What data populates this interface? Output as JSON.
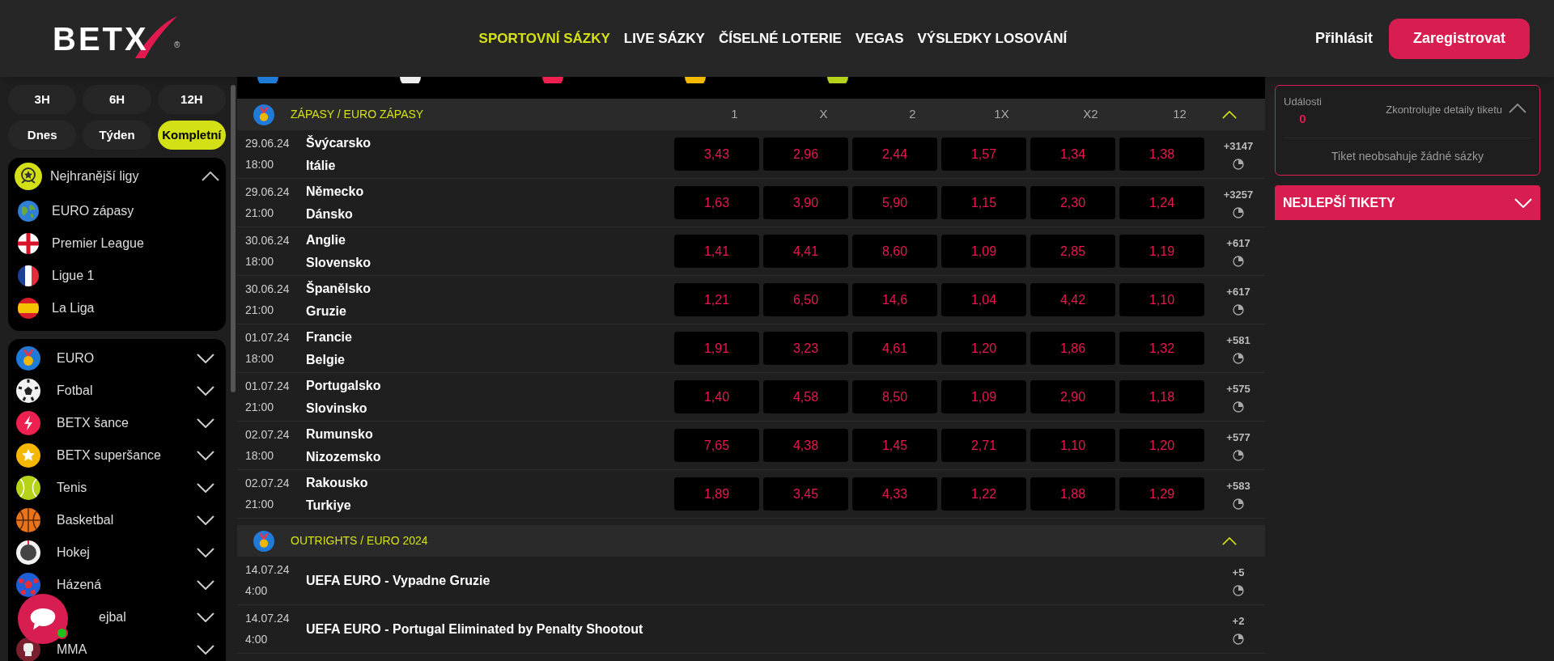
{
  "header": {
    "logo": "BETX",
    "logo_mark": "®",
    "nav": [
      {
        "label": "SPORTOVNÍ SÁZKY",
        "selected": true
      },
      {
        "label": "LIVE SÁZKY",
        "selected": false
      },
      {
        "label": "ČÍSELNÉ LOTERIE",
        "selected": false
      },
      {
        "label": "VEGAS",
        "selected": false
      },
      {
        "label": "VÝSLEDKY LOSOVÁNÍ",
        "selected": false
      }
    ],
    "login": "Přihlásit",
    "register": "Zaregistrovat"
  },
  "time_filters": [
    {
      "label": "3H",
      "selected": false
    },
    {
      "label": "6H",
      "selected": false
    },
    {
      "label": "12H",
      "selected": false
    },
    {
      "label": "Dnes",
      "selected": false
    },
    {
      "label": "Týden",
      "selected": false
    },
    {
      "label": "Kompletní",
      "selected": true
    }
  ],
  "top_leagues": {
    "title": "Nejhranější ligy",
    "expanded": true,
    "items": [
      "EURO zápasy",
      "Premier League",
      "Ligue 1",
      "La Liga"
    ]
  },
  "sports": [
    {
      "label": "EURO",
      "expanded": false
    },
    {
      "label": "Fotbal",
      "expanded": false
    },
    {
      "label": "BETX šance",
      "expanded": false
    },
    {
      "label": "BETX superšance",
      "expanded": false
    },
    {
      "label": "Tenis",
      "expanded": false
    },
    {
      "label": "Basketbal",
      "expanded": false
    },
    {
      "label": "Hokej",
      "expanded": false
    },
    {
      "label": "Házená",
      "expanded": false
    },
    {
      "label": "ejbal",
      "expanded": false,
      "partial": true
    },
    {
      "label": "MMA",
      "expanded": false
    }
  ],
  "sections": [
    {
      "title": "ZÁPASY / EURO ZÁPASY",
      "kind": "matches",
      "expanded": true,
      "columns": [
        "1",
        "X",
        "2",
        "1X",
        "X2",
        "12"
      ],
      "rows": [
        {
          "date": "29.06.24",
          "time": "18:00",
          "home": "Švýcarsko",
          "away": "Itálie",
          "odds": [
            "3,43",
            "2,96",
            "2,44",
            "1,57",
            "1,34",
            "1,38"
          ],
          "more": "+3147"
        },
        {
          "date": "29.06.24",
          "time": "21:00",
          "home": "Německo",
          "away": "Dánsko",
          "odds": [
            "1,63",
            "3,90",
            "5,90",
            "1,15",
            "2,30",
            "1,24"
          ],
          "more": "+3257"
        },
        {
          "date": "30.06.24",
          "time": "18:00",
          "home": "Anglie",
          "away": "Slovensko",
          "odds": [
            "1,41",
            "4,41",
            "8,60",
            "1,09",
            "2,85",
            "1,19"
          ],
          "more": "+617"
        },
        {
          "date": "30.06.24",
          "time": "21:00",
          "home": "Španělsko",
          "away": "Gruzie",
          "odds": [
            "1,21",
            "6,50",
            "14,6",
            "1,04",
            "4,42",
            "1,10"
          ],
          "more": "+617"
        },
        {
          "date": "01.07.24",
          "time": "18:00",
          "home": "Francie",
          "away": "Belgie",
          "odds": [
            "1,91",
            "3,23",
            "4,61",
            "1,20",
            "1,86",
            "1,32"
          ],
          "more": "+581"
        },
        {
          "date": "01.07.24",
          "time": "21:00",
          "home": "Portugalsko",
          "away": "Slovinsko",
          "odds": [
            "1,40",
            "4,58",
            "8,50",
            "1,09",
            "2,90",
            "1,18"
          ],
          "more": "+575"
        },
        {
          "date": "02.07.24",
          "time": "18:00",
          "home": "Rumunsko",
          "away": "Nizozemsko",
          "odds": [
            "7,65",
            "4,38",
            "1,45",
            "2,71",
            "1,10",
            "1,20"
          ],
          "more": "+577"
        },
        {
          "date": "02.07.24",
          "time": "21:00",
          "home": "Rakousko",
          "away": "Turkiye",
          "odds": [
            "1,89",
            "3,45",
            "4,33",
            "1,22",
            "1,88",
            "1,29"
          ],
          "more": "+583"
        }
      ]
    },
    {
      "title": "OUTRIGHTS / EURO 2024",
      "kind": "outrights",
      "expanded": true,
      "rows": [
        {
          "date": "14.07.24",
          "time": "4:00",
          "name": "UEFA EURO - Vypadne Gruzie",
          "more": "+5"
        },
        {
          "date": "14.07.24",
          "time": "4:00",
          "name": "UEFA EURO - Portugal Eliminated by Penalty Shootout",
          "more": "+2"
        }
      ]
    }
  ],
  "ticket": {
    "events_label": "Události",
    "events_count": "0",
    "details": "Zkontrolujte detaily tiketu",
    "expanded": true,
    "empty": "Tiket neobsahuje žádné sázky"
  },
  "best_tickets": {
    "title": "NEJLEPŠÍ TIKETY",
    "expanded": false
  }
}
